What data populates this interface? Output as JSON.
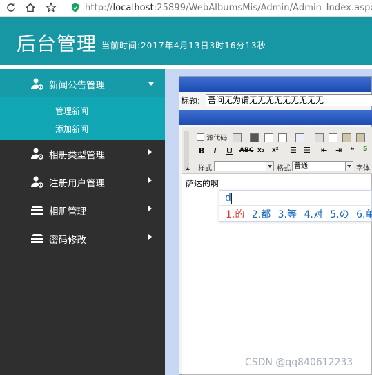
{
  "browser": {
    "url_prefix": "http://",
    "url_host": "localhost",
    "url_rest": ":25899/WebAlbumsMis/Admin/Admin_Index.aspx"
  },
  "header": {
    "brand": "后台管理",
    "clock": "当前时间:2017年4月13日3时16分13秒"
  },
  "sidebar": {
    "items": [
      {
        "label": "新闻公告管理",
        "icon": "user-gear-icon"
      },
      {
        "label": "相册类型管理",
        "icon": "user-gear-icon"
      },
      {
        "label": "注册用户管理",
        "icon": "user-gear-icon"
      },
      {
        "label": "相册管理",
        "icon": "stack-icon"
      },
      {
        "label": "密码修改",
        "icon": "stack-icon"
      }
    ],
    "submenu": [
      "管理新闻",
      "添加新闻"
    ]
  },
  "form": {
    "title_label": "标题:",
    "title_value": "吾问无为谓无无无无无无无无无"
  },
  "editor": {
    "source_label": "源代码",
    "style_label": "样式",
    "format_label": "格式",
    "format_value": "普通",
    "font_label": "字体",
    "content": "萨达的啊"
  },
  "ime": {
    "composition": "d",
    "candidates": [
      {
        "num": "1.",
        "text": "的"
      },
      {
        "num": "2.",
        "text": "都"
      },
      {
        "num": "3.",
        "text": "等"
      },
      {
        "num": "4.",
        "text": "对"
      },
      {
        "num": "5.",
        "text": "の"
      },
      {
        "num": "6.",
        "text": "单"
      }
    ]
  },
  "watermark": "CSDN @qq840612233",
  "colors": {
    "header": "#1797a3",
    "sidebar": "#2f2f2f",
    "active": "#169ba8",
    "submenu": "#10a6b3",
    "main": "#c6d6f3"
  }
}
